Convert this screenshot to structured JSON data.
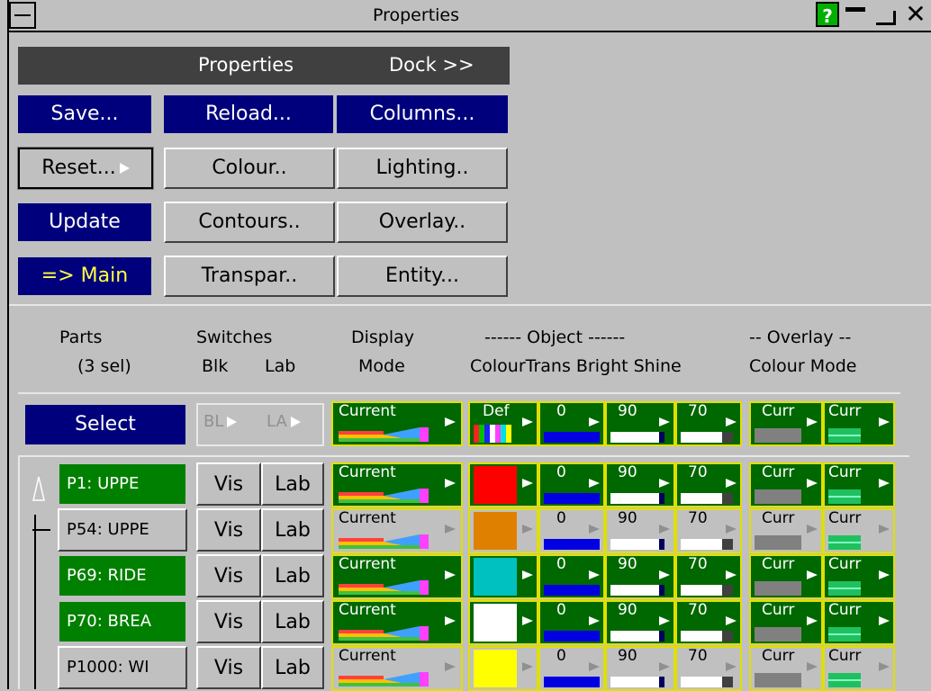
{
  "window": {
    "title": "Properties"
  },
  "header": {
    "title": "Properties",
    "dock": "Dock >>"
  },
  "buttons": {
    "save": "Save...",
    "reload": "Reload...",
    "columns": "Columns...",
    "reset": "Reset...",
    "colour": "Colour..",
    "lighting": "Lighting..",
    "update": "Update",
    "contours": "Contours..",
    "overlay": "Overlay..",
    "main": "=> Main",
    "transpar": "Transpar..",
    "entity": "Entity..."
  },
  "columns": {
    "parts": "Parts",
    "parts_sel": "(3 sel)",
    "switches": "Switches",
    "blk": "Blk",
    "lab": "Lab",
    "display": "Display",
    "mode": "Mode",
    "object": "------ Object ------",
    "object_sub": "ColourTrans Bright Shine",
    "overlay": "-- Overlay --",
    "overlay_sub": "Colour Mode"
  },
  "control_row": {
    "select": "Select",
    "bl": "BL",
    "la": "LA",
    "display": "Current",
    "colour": "Def",
    "trans": "0",
    "bright": "90",
    "shine": "70",
    "ov_colour": "Curr",
    "ov_mode": "Curr"
  },
  "rows": [
    {
      "part": "P1: UPPE",
      "selected": true,
      "vis": "Vis",
      "lab": "Lab",
      "display": "Current",
      "colour_hex": "#ff0000",
      "trans": "0",
      "bright": "90",
      "shine": "70",
      "ov_colour": "Curr",
      "ov_mode": "Curr"
    },
    {
      "part": "P54: UPPE",
      "selected": false,
      "vis": "Vis",
      "lab": "Lab",
      "display": "Current",
      "colour_hex": "#e08000",
      "trans": "0",
      "bright": "90",
      "shine": "70",
      "ov_colour": "Curr",
      "ov_mode": "Curr"
    },
    {
      "part": "P69: RIDE",
      "selected": true,
      "vis": "Vis",
      "lab": "Lab",
      "display": "Current",
      "colour_hex": "#00c0c0",
      "trans": "0",
      "bright": "90",
      "shine": "70",
      "ov_colour": "Curr",
      "ov_mode": "Curr"
    },
    {
      "part": "P70: BREA",
      "selected": true,
      "vis": "Vis",
      "lab": "Lab",
      "display": "Current",
      "colour_hex": "#ffffff",
      "trans": "0",
      "bright": "90",
      "shine": "70",
      "ov_colour": "Curr",
      "ov_mode": "Curr"
    },
    {
      "part": "P1000: WI",
      "selected": false,
      "vis": "Vis",
      "lab": "Lab",
      "display": "Current",
      "colour_hex": "#ffff00",
      "trans": "0",
      "bright": "90",
      "shine": "70",
      "ov_colour": "Curr",
      "ov_mode": "Curr"
    }
  ]
}
